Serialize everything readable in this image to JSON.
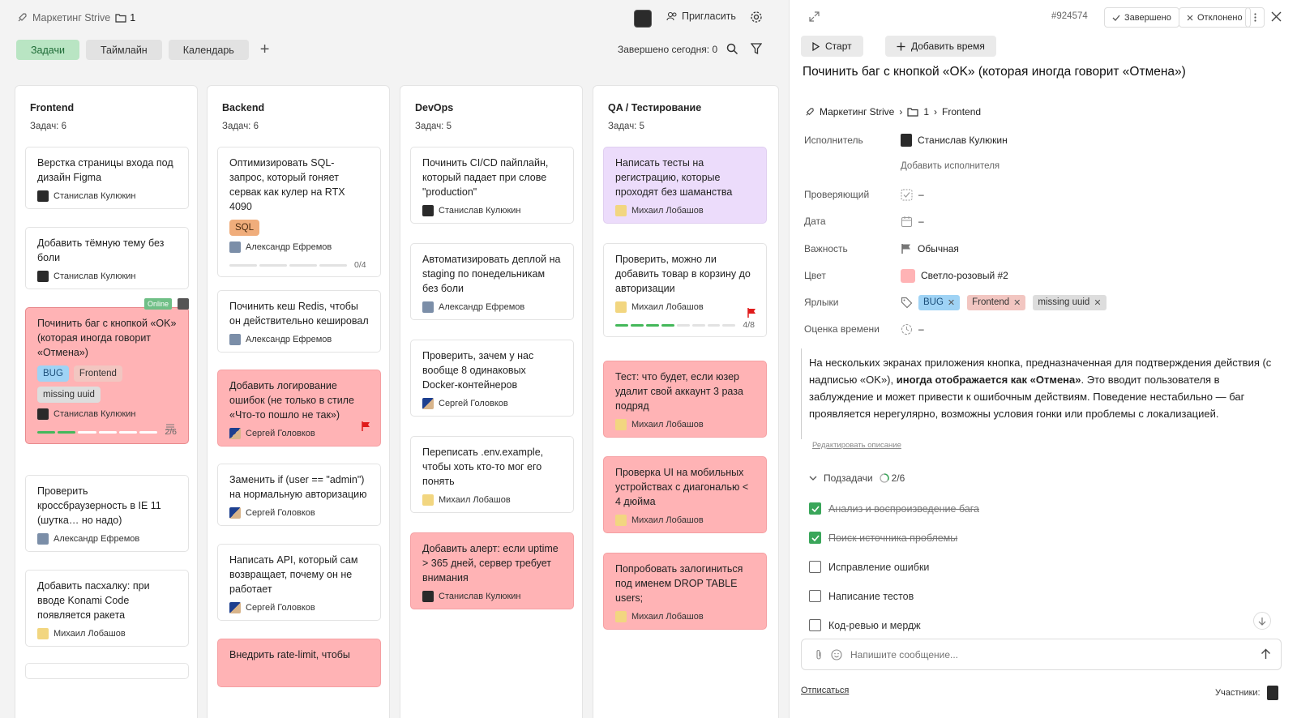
{
  "topbar": {
    "project": "Маркетинг Strive",
    "folder_count": "1",
    "invite": "Пригласить"
  },
  "tabs": [
    {
      "label": "Задачи"
    },
    {
      "label": "Таймлайн"
    },
    {
      "label": "Календарь"
    }
  ],
  "done_today": "Завершено сегодня: 0",
  "columns": [
    {
      "title": "Frontend",
      "count": "Задач: 6",
      "cards": [
        {
          "title": "Верстка страницы входа под дизайн Figma",
          "assignee": "Станислав Кулюкин"
        },
        {
          "title": "Добавить тёмную тему без боли",
          "assignee": "Станислав Кулюкин"
        },
        {
          "title": "Починить баг с кнопкой «OK» (которая иногда говорит «Отмена»)",
          "assignee": "Станислав Кулюкин",
          "online": "Online",
          "chips": [
            "BUG",
            "Frontend",
            "missing uuid"
          ],
          "progress": "2/6"
        },
        {
          "title": "Проверить кроссбраузерность в IE 11 (шутка… но надо)",
          "assignee": "Александр Ефремов"
        },
        {
          "title": "Добавить пасхалку: при вводе Konami Code появляется ракета",
          "assignee": "Михаил Лобашов"
        }
      ]
    },
    {
      "title": "Backend",
      "count": "Задач: 6",
      "cards": [
        {
          "title": "Оптимизировать SQL-запрос, который гоняет сервак как кулер на RTX 4090",
          "assignee": "Александр Ефремов",
          "chip": "SQL",
          "progress": "0/4"
        },
        {
          "title": "Починить кеш Redis, чтобы он действительно кешировал",
          "assignee": "Александр Ефремов"
        },
        {
          "title": "Добавить логирование ошибок (не только в стиле «Что-то пошло не так»)",
          "assignee": "Сергей Головков"
        },
        {
          "title": "Заменить if (user == \"admin\") на нормальную авторизацию",
          "assignee": "Сергей Головков"
        },
        {
          "title": "Написать API, который сам возвращает, почему он не работает",
          "assignee": "Сергей Головков"
        },
        {
          "title": "Внедрить rate-limit, чтобы"
        }
      ]
    },
    {
      "title": "DevOps",
      "count": "Задач: 5",
      "cards": [
        {
          "title": "Починить CI/CD пайплайн, который падает при слове \"production\"",
          "assignee": "Станислав Кулюкин"
        },
        {
          "title": "Автоматизировать деплой на staging по понедельникам без боли",
          "assignee": "Александр Ефремов"
        },
        {
          "title": "Проверить, зачем у нас вообще 8 одинаковых Docker-контейнеров",
          "assignee": "Сергей Головков"
        },
        {
          "title": "Переписать .env.example, чтобы хоть кто-то мог его понять",
          "assignee": "Михаил Лобашов"
        },
        {
          "title": "Добавить алерт: если uptime > 365 дней, сервер требует внимания",
          "assignee": "Станислав Кулюкин"
        }
      ]
    },
    {
      "title": "QA / Тестирование",
      "count": "Задач: 5",
      "cards": [
        {
          "title": "Написать тесты на регистрацию, которые проходят без шаманства",
          "assignee": "Михаил Лобашов"
        },
        {
          "title": "Проверить, можно ли добавить товар в корзину до авторизации",
          "assignee": "Михаил Лобашов",
          "progress": "4/8"
        },
        {
          "title": "Тест: что будет, если юзер удалит свой аккаунт 3 раза подряд",
          "assignee": "Михаил Лобашов"
        },
        {
          "title": "Проверка UI на мобильных устройствах с диагональю < 4 дюйма",
          "assignee": "Михаил Лобашов"
        },
        {
          "title": "Попробовать залогиниться под именем DROP TABLE users;",
          "assignee": "Михаил Лобашов"
        }
      ]
    }
  ],
  "panel": {
    "id": "#924574",
    "btn_done": "Завершено",
    "btn_rejected": "Отклонено",
    "btn_start": "Старт",
    "btn_add_time": "Добавить время",
    "title": "Починить баг с кнопкой «OK» (которая иногда говорит «Отмена»)",
    "crumbs": {
      "project": "Маркетинг Strive",
      "folder": "1",
      "column": "Frontend"
    },
    "fields": {
      "assignee_label": "Исполнитель",
      "assignee": "Станислав Кулюкин",
      "add_assignee": "Добавить исполнителя",
      "reviewer_label": "Проверяющий",
      "reviewer": "–",
      "date_label": "Дата",
      "date": "–",
      "priority_label": "Важность",
      "priority": "Обычная",
      "color_label": "Цвет",
      "color": "Светло-розовый #2",
      "color_hex": "#ffb3b5",
      "labels_label": "Ярлыки",
      "labels": [
        "BUG",
        "Frontend",
        "missing uuid"
      ],
      "estimate_label": "Оценка времени",
      "estimate": "–"
    },
    "desc_part1": "На нескольких экранах приложения кнопка, предназначенная для подтверждения действия (с надписью «OK»), ",
    "desc_bold": "иногда отображается как «Отмена»",
    "desc_part2": ". Это вводит пользователя в заблуждение и может привести к ошибочным действиям. Поведение нестабильно — баг проявляется нерегулярно, возможны условия гонки или проблемы с локализацией.",
    "edit_desc": "Редактировать описание",
    "subtasks_label": "Подзадачи",
    "subtasks_progress": "2/6",
    "subtasks": [
      {
        "label": "Анализ и воспроизведение бага",
        "done": true
      },
      {
        "label": "Поиск источника проблемы",
        "done": true
      },
      {
        "label": "Исправление ошибки",
        "done": false
      },
      {
        "label": "Написание тестов",
        "done": false
      },
      {
        "label": "Код-ревью и мердж",
        "done": false
      }
    ],
    "message_placeholder": "Напишите сообщение...",
    "unsubscribe": "Отписаться",
    "members": "Участники:"
  }
}
